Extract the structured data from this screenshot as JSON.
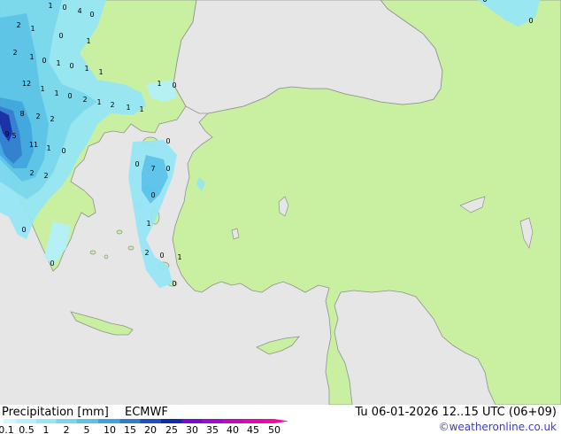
{
  "legend": {
    "title": "Precipitation [mm]",
    "model": "ECMWF",
    "valid_time": "Tu 06-01-2026 12..15 UTC (06+09)",
    "credit": "©weatheronline.co.uk",
    "scale_labels": [
      "0.1",
      "0.5",
      "1",
      "2",
      "5",
      "10",
      "15",
      "20",
      "25",
      "30",
      "35",
      "40",
      "45",
      "50"
    ],
    "scale_colors": [
      "#d2f7ff",
      "#b4f0fa",
      "#96e6f5",
      "#78d7f0",
      "#5ac3eb",
      "#3ca5e1",
      "#2d7dd2",
      "#1e50c3",
      "#1428aa",
      "#780ad2",
      "#a00ad7",
      "#c30ac3",
      "#dc0ab4",
      "#f50aa0"
    ]
  },
  "colors": {
    "sea": "#e6e6e6",
    "land": "#c8f0a0",
    "coast": "#909090"
  },
  "point_values": [
    {
      "t": "1"
    },
    {
      "t": "0"
    },
    {
      "t": "4"
    },
    {
      "t": "0"
    },
    {
      "t": "2"
    },
    {
      "t": "1"
    },
    {
      "t": "0"
    },
    {
      "t": "1"
    },
    {
      "t": "2"
    },
    {
      "t": "1"
    },
    {
      "t": "0"
    },
    {
      "t": "1"
    },
    {
      "t": "0"
    },
    {
      "t": "1"
    },
    {
      "t": "1"
    },
    {
      "t": "12"
    },
    {
      "t": "1"
    },
    {
      "t": "1"
    },
    {
      "t": "0"
    },
    {
      "t": "2"
    },
    {
      "t": "1"
    },
    {
      "t": "2"
    },
    {
      "t": "1"
    },
    {
      "t": "1"
    },
    {
      "t": "1"
    },
    {
      "t": "0"
    },
    {
      "t": "8"
    },
    {
      "t": "2"
    },
    {
      "t": "2"
    },
    {
      "t": "9"
    },
    {
      "t": "5"
    },
    {
      "t": "11"
    },
    {
      "t": "1"
    },
    {
      "t": "0"
    },
    {
      "t": "2"
    },
    {
      "t": "2"
    },
    {
      "t": "0"
    },
    {
      "t": "0"
    },
    {
      "t": "7"
    },
    {
      "t": "0"
    },
    {
      "t": "0"
    },
    {
      "t": "0"
    },
    {
      "t": "1"
    },
    {
      "t": "0"
    },
    {
      "t": "2"
    },
    {
      "t": "0"
    },
    {
      "t": "1"
    },
    {
      "t": "0"
    },
    {
      "t": "0"
    },
    {
      "t": "0"
    }
  ]
}
